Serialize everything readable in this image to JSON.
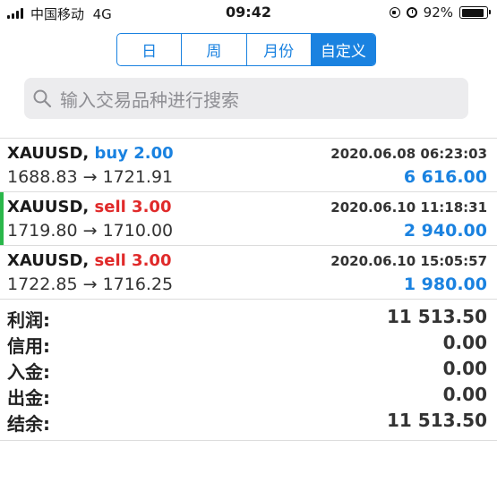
{
  "status_bar": {
    "carrier": "中国移动",
    "network": "4G",
    "time": "09:42",
    "battery": "92%",
    "battery_level": 0.92
  },
  "tabs": [
    {
      "label": "日",
      "active": false
    },
    {
      "label": "周",
      "active": false
    },
    {
      "label": "月份",
      "active": false
    },
    {
      "label": "自定义",
      "active": true
    }
  ],
  "search": {
    "placeholder": "输入交易品种进行搜索"
  },
  "trades": [
    {
      "symbol": "XAUUSD",
      "sep": ",",
      "side": "buy 2.00",
      "side_type": "buy",
      "prices": "1688.83 → 1721.91",
      "time": "2020.06.08 06:23:03",
      "profit": "6 616.00",
      "highlighted": false
    },
    {
      "symbol": "XAUUSD",
      "sep": ",",
      "side": "sell 3.00",
      "side_type": "sell",
      "prices": "1719.80 → 1710.00",
      "time": "2020.06.10 11:18:31",
      "profit": "2 940.00",
      "highlighted": true
    },
    {
      "symbol": "XAUUSD",
      "sep": ",",
      "side": "sell 3.00",
      "side_type": "sell",
      "prices": "1722.85 → 1716.25",
      "time": "2020.06.10 15:05:57",
      "profit": "1 980.00",
      "highlighted": false
    }
  ],
  "summary": {
    "profit_label": "利润:",
    "profit_value": "11 513.50",
    "credit_label": "信用:",
    "credit_value": "0.00",
    "deposit_label": "入金:",
    "deposit_value": "0.00",
    "withdrawal_label": "出金:",
    "withdrawal_value": "0.00",
    "balance_label": "结余:",
    "balance_value": "11 513.50"
  },
  "colors": {
    "accent": "#1a82e0",
    "buy": "#1a82e0",
    "sell": "#e02a2a",
    "highlight_bar": "#2ab74a"
  }
}
